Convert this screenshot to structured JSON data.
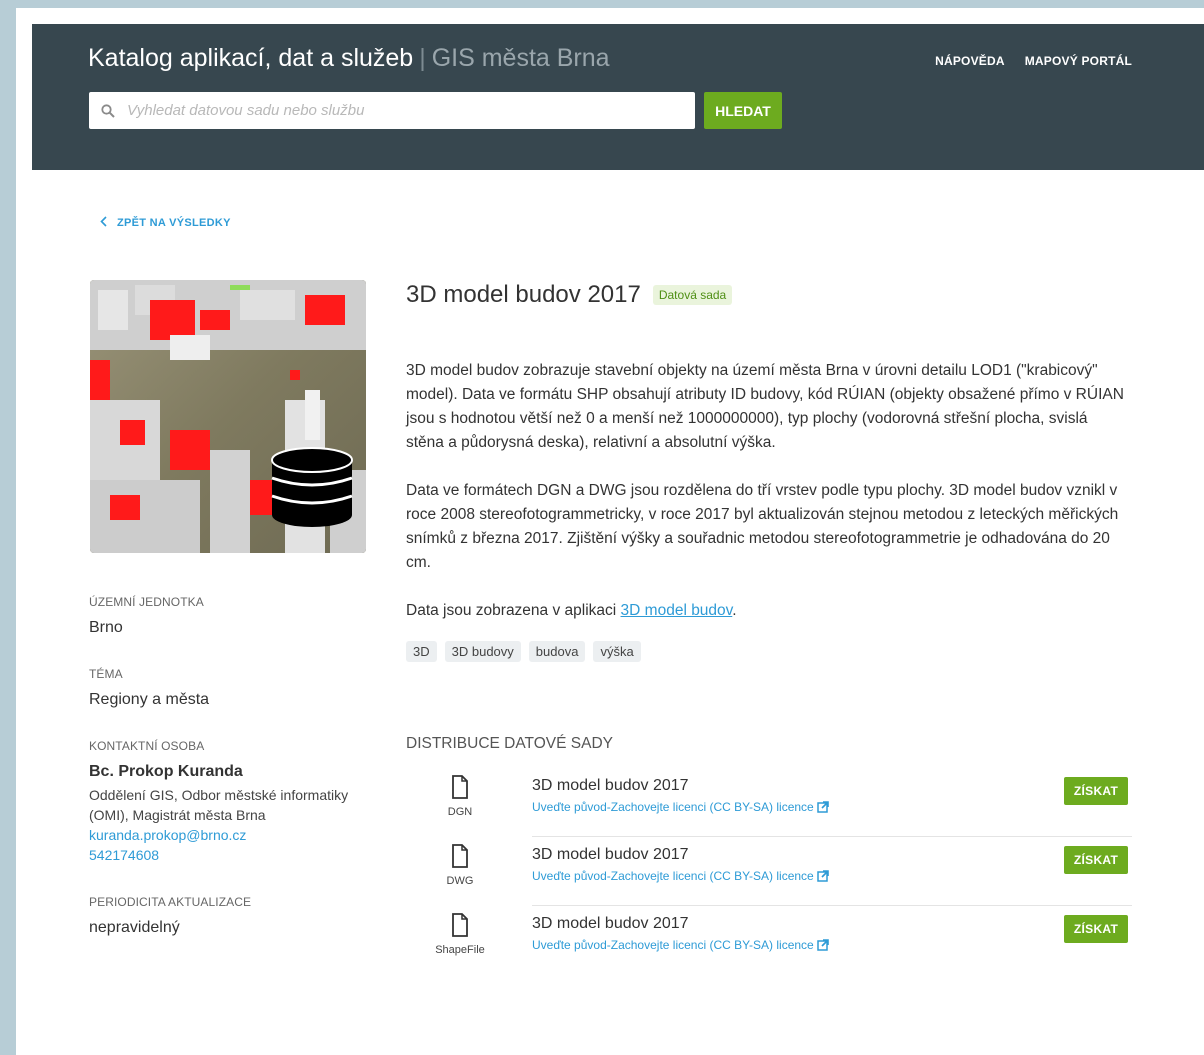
{
  "header": {
    "brand_title": "Katalog aplikací, dat a služeb",
    "brand_separator": "|",
    "brand_subtitle": "GIS města Brna",
    "nav": [
      {
        "label": "NÁPOVĚDA"
      },
      {
        "label": "MAPOVÝ PORTÁL"
      }
    ],
    "search_placeholder": "Vyhledat datovou sadu nebo službu",
    "search_button": "HLEDAT"
  },
  "back_link": "ZPĚT NA VÝSLEDKY",
  "dataset": {
    "title": "3D model budov 2017",
    "type_badge": "Datová sada",
    "description_1": "3D model budov zobrazuje stavební objekty na území města Brna v úrovni detailu LOD1 (\"krabicový\" model). Data ve formátu SHP obsahují atributy ID budovy, kód RÚIAN (objekty obsažené přímo v RÚIAN jsou s hodnotou větší než 0 a menší než 1000000000), typ plochy (vodorovná střešní plocha, svislá stěna a půdorysná deska), relativní a absolutní výška.",
    "description_2": "Data ve formátech DGN a DWG jsou rozdělena do tří vrstev podle typu plochy. 3D model budov vznikl v roce 2008 stereofotogrammetricky, v roce 2017 byl aktualizován stejnou metodou z leteckých měřických snímků z března 2017. Zjištění výšky a souřadnic metodou stereofotogrammetrie je odhadována do 20 cm.",
    "app_text_prefix": "Data jsou zobrazena v aplikaci ",
    "app_link": "3D model budov",
    "app_text_suffix": ".",
    "tags": [
      "3D",
      "3D budovy",
      "budova",
      "výška"
    ]
  },
  "sidebar": {
    "unit_label": "ÚZEMNÍ JEDNOTKA",
    "unit_value": "Brno",
    "theme_label": "TÉMA",
    "theme_value": "Regiony a města",
    "contact_label": "KONTAKTNÍ OSOBA",
    "contact_name": "Bc. Prokop Kuranda",
    "contact_dept_1": "Oddělení GIS, Odbor městské informatiky",
    "contact_dept_2": "(OMI), Magistrát města Brna",
    "contact_email": "kuranda.prokop@brno.cz",
    "contact_phone": "542174608",
    "period_label": "PERIODICITA AKTUALIZACE",
    "period_value": "nepravidelný"
  },
  "distribution": {
    "title": "DISTRIBUCE DATOVÉ SADY",
    "items": [
      {
        "format": "DGN",
        "name": "3D model budov 2017",
        "license": "Uveďte původ-Zachovejte licenci (CC BY-SA) licence",
        "button": "ZÍSKAT"
      },
      {
        "format": "DWG",
        "name": "3D model budov 2017",
        "license": "Uveďte původ-Zachovejte licenci (CC BY-SA) licence",
        "button": "ZÍSKAT"
      },
      {
        "format": "ShapeFile",
        "name": "3D model budov 2017",
        "license": "Uveďte původ-Zachovejte licenci (CC BY-SA) licence",
        "button": "ZÍSKAT"
      }
    ]
  },
  "colors": {
    "header_bg": "#37474f",
    "accent_green": "#6dab1f",
    "link_blue": "#2e9bd6"
  },
  "icons": {
    "search": "search-icon",
    "back": "chevron-left-icon",
    "file": "file-icon",
    "external": "external-link-icon",
    "database": "database-icon"
  }
}
